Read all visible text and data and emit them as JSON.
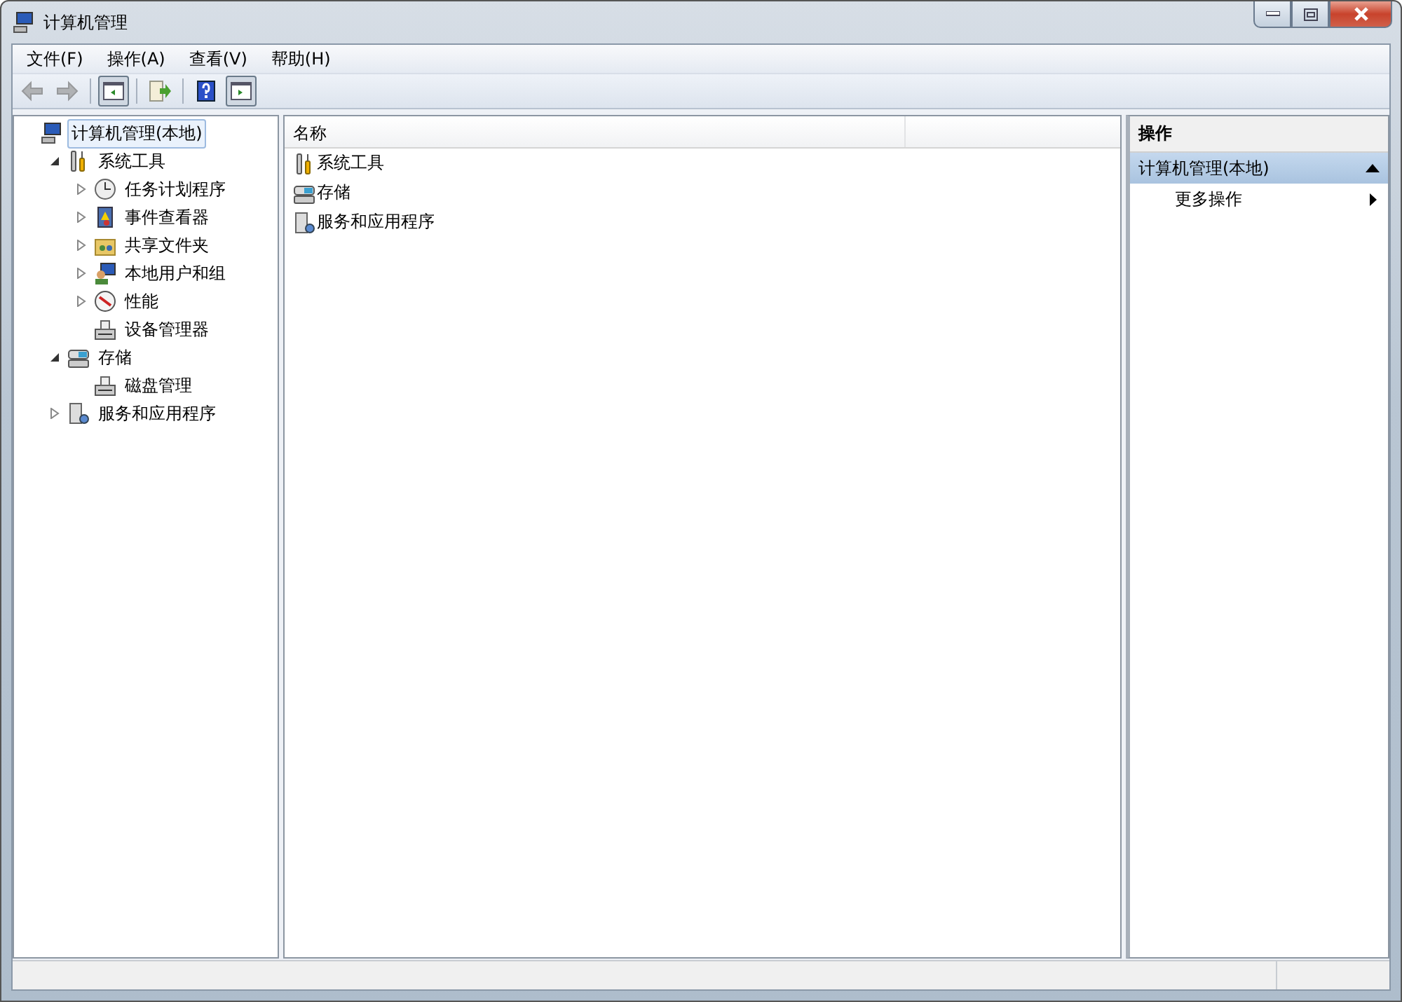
{
  "window": {
    "title": "计算机管理"
  },
  "menu": [
    {
      "label": "文件(F)"
    },
    {
      "label": "操作(A)"
    },
    {
      "label": "查看(V)"
    },
    {
      "label": "帮助(H)"
    }
  ],
  "toolbar": [
    {
      "kind": "back",
      "disabled": true,
      "pressed": false
    },
    {
      "kind": "forward",
      "disabled": true,
      "pressed": false
    },
    {
      "kind": "tree-pane",
      "disabled": false,
      "pressed": true
    },
    {
      "kind": "export",
      "disabled": false,
      "pressed": false
    },
    {
      "kind": "help",
      "disabled": false,
      "pressed": false
    },
    {
      "kind": "action-pane",
      "disabled": false,
      "pressed": true
    }
  ],
  "tree": [
    {
      "label": "计算机管理(本地)",
      "kind": "computer",
      "selected": true,
      "children": [
        {
          "label": "系统工具",
          "kind": "tools",
          "selected": false,
          "expanded": true,
          "children": [
            {
              "label": "任务计划程序",
              "kind": "clock",
              "selected": false,
              "expanded": false
            },
            {
              "label": "事件查看器",
              "kind": "event",
              "selected": false,
              "expanded": false
            },
            {
              "label": "共享文件夹",
              "kind": "share",
              "selected": false,
              "expanded": false
            },
            {
              "label": "本地用户和组",
              "kind": "users",
              "selected": false,
              "expanded": false
            },
            {
              "label": "性能",
              "kind": "perf",
              "selected": false,
              "expanded": false
            },
            {
              "label": "设备管理器",
              "kind": "device",
              "selected": false
            }
          ]
        },
        {
          "label": "存储",
          "kind": "storage",
          "selected": false,
          "expanded": true,
          "children": [
            {
              "label": "磁盘管理",
              "kind": "device",
              "selected": false
            }
          ]
        },
        {
          "label": "服务和应用程序",
          "kind": "services",
          "selected": false,
          "expanded": false
        }
      ]
    }
  ],
  "list": {
    "columns": [
      "名称"
    ],
    "rows": [
      {
        "label": "系统工具",
        "kind": "tools"
      },
      {
        "label": "存储",
        "kind": "storage"
      },
      {
        "label": "服务和应用程序",
        "kind": "services"
      }
    ]
  },
  "actions": {
    "title": "操作",
    "section": {
      "label": "计算机管理(本地)",
      "expanded": true
    },
    "items": [
      {
        "label": "更多操作"
      }
    ]
  }
}
